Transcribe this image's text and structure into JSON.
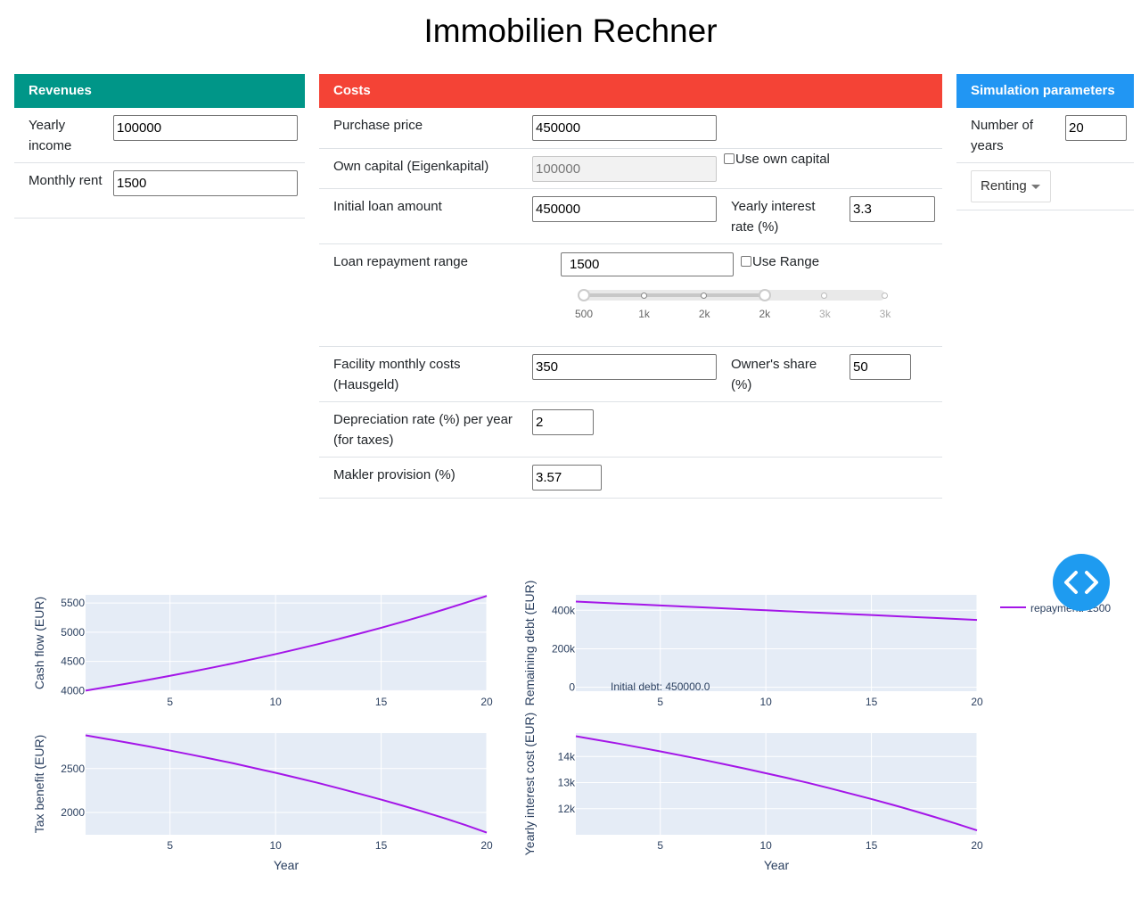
{
  "page": {
    "title": "Immobilien Rechner"
  },
  "revenues": {
    "header": "Revenues",
    "yearly_income_label": "Yearly income",
    "yearly_income_value": "100000",
    "monthly_rent_label": "Monthly rent",
    "monthly_rent_value": "1500"
  },
  "costs": {
    "header": "Costs",
    "purchase_price_label": "Purchase price",
    "purchase_price_value": "450000",
    "own_capital_label": "Own capital (Eigenkapital)",
    "own_capital_value": "100000",
    "use_own_capital_label": "Use own capital",
    "use_own_capital_checked": false,
    "initial_loan_label": "Initial loan amount",
    "initial_loan_value": "450000",
    "interest_rate_label": "Yearly interest rate (%)",
    "interest_rate_value": "3.3",
    "repayment_label": "Loan repayment range",
    "repayment_value": "1500",
    "use_range_label": "Use Range",
    "use_range_checked": false,
    "slider": {
      "marks": [
        "500",
        "1k",
        "2k",
        "2k",
        "3k",
        "3k"
      ],
      "min": 500,
      "max": 3000,
      "range_low": 500,
      "range_high": 2000
    },
    "facility_label": "Facility monthly costs (Hausgeld)",
    "facility_value": "350",
    "owners_share_label": "Owner's share (%)",
    "owners_share_value": "50",
    "depreciation_label": "Depreciation rate (%) per year (for taxes)",
    "depreciation_value": "2",
    "makler_label": "Makler provision (%)",
    "makler_value": "3.57"
  },
  "simulation": {
    "header": "Simulation parameters",
    "years_label": "Number of years",
    "years_value": "20",
    "mode_selected": "Renting"
  },
  "colors": {
    "revenues": "#009688",
    "costs": "#f44336",
    "simulation": "#2196f3",
    "line": "#a416e8",
    "plot_bg": "#e5ecf6",
    "code_button": "#1e9bf0"
  },
  "icons": {
    "code_button": "code-icon",
    "dropdown": "caret-down-icon"
  },
  "chart_data": [
    {
      "type": "line",
      "xlabel": "",
      "ylabel": "Cash flow (EUR)",
      "x": [
        1,
        2,
        3,
        4,
        5,
        6,
        7,
        8,
        9,
        10,
        11,
        12,
        13,
        14,
        15,
        16,
        17,
        18,
        19,
        20
      ],
      "series": [
        {
          "values": [
            4000,
            4060,
            4122,
            4186,
            4253,
            4322,
            4394,
            4468,
            4545,
            4625,
            4709,
            4795,
            4885,
            4979,
            5076,
            5177,
            5282,
            5392,
            5505,
            5622
          ]
        }
      ],
      "xticks": [
        "5",
        "10",
        "15",
        "20"
      ],
      "yticks": [
        "4000",
        "4500",
        "5000",
        "5500"
      ],
      "xlim": [
        1,
        20
      ],
      "ylim": [
        3990,
        5640
      ]
    },
    {
      "type": "line",
      "xlabel": "",
      "ylabel": "Remaining debt (EUR)",
      "x": [
        1,
        2,
        3,
        4,
        5,
        6,
        7,
        8,
        9,
        10,
        11,
        12,
        13,
        14,
        15,
        16,
        17,
        18,
        19,
        20
      ],
      "series": [
        {
          "name": "repayment: 1500",
          "values": [
            445000,
            440000,
            435000,
            430000,
            425000,
            420000,
            415000,
            410000,
            405000,
            400000,
            395000,
            390000,
            385000,
            380000,
            375000,
            370000,
            365000,
            360000,
            355000,
            350000
          ]
        }
      ],
      "xticks": [
        "5",
        "10",
        "15",
        "20"
      ],
      "yticks": [
        "0",
        "200k",
        "400k"
      ],
      "annotation": "Initial debt: 450000.0",
      "xlim": [
        1,
        20
      ],
      "ylim": [
        -20000,
        480000
      ]
    },
    {
      "type": "line",
      "xlabel": "Year",
      "ylabel": "Tax benefit (EUR)",
      "x": [
        1,
        2,
        3,
        4,
        5,
        6,
        7,
        8,
        9,
        10,
        11,
        12,
        13,
        14,
        15,
        16,
        17,
        18,
        19,
        20
      ],
      "series": [
        {
          "values": [
            2880,
            2838,
            2796,
            2752,
            2706,
            2659,
            2610,
            2560,
            2506,
            2452,
            2395,
            2337,
            2275,
            2211,
            2146,
            2078,
            2008,
            1934,
            1855,
            1770
          ]
        }
      ],
      "xticks": [
        "5",
        "10",
        "15",
        "20"
      ],
      "yticks": [
        "2000",
        "2500"
      ],
      "xlim": [
        1,
        20
      ],
      "ylim": [
        1745,
        2905
      ]
    },
    {
      "type": "line",
      "xlabel": "Year",
      "ylabel": "Yearly interest cost (EUR)",
      "x": [
        1,
        2,
        3,
        4,
        5,
        6,
        7,
        8,
        9,
        10,
        11,
        12,
        13,
        14,
        15,
        16,
        17,
        18,
        19,
        20
      ],
      "series": [
        {
          "values": [
            14780,
            14640,
            14500,
            14350,
            14200,
            14040,
            13880,
            13710,
            13540,
            13360,
            13180,
            12990,
            12790,
            12580,
            12370,
            12150,
            11920,
            11680,
            11430,
            11170
          ]
        }
      ],
      "xticks": [
        "5",
        "10",
        "15",
        "20"
      ],
      "yticks": [
        "12k",
        "13k",
        "14k"
      ],
      "xlim": [
        1,
        20
      ],
      "ylim": [
        11000,
        14900
      ]
    }
  ]
}
